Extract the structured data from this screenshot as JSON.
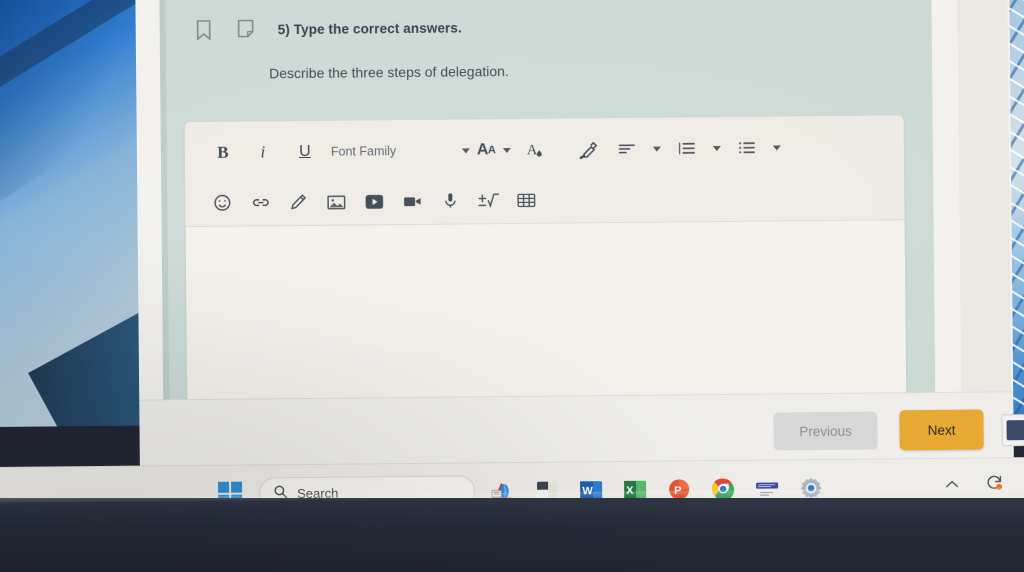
{
  "question": {
    "number_label": "5) Type the correct answers.",
    "prompt": "Describe the three steps of delegation.",
    "bookmark_icon": "bookmark-icon",
    "note_icon": "note-icon",
    "background_color": "#c9d8d4"
  },
  "editor": {
    "toolbar_row1": [
      {
        "name": "bold-button",
        "label": "B",
        "type": "text"
      },
      {
        "name": "italic-button",
        "label": "i",
        "type": "text"
      },
      {
        "name": "underline-button",
        "label": "U",
        "type": "text"
      },
      {
        "name": "font-family-select",
        "label": "Font Family",
        "type": "select"
      },
      {
        "name": "font-size-button",
        "label": "AA",
        "type": "select"
      },
      {
        "name": "font-color-button",
        "label": "font-color-icon",
        "type": "icon"
      },
      {
        "name": "highlight-button",
        "label": "highlighter-icon",
        "type": "icon"
      },
      {
        "name": "align-button",
        "label": "align-left-icon",
        "type": "select"
      },
      {
        "name": "numbered-list-button",
        "label": "numbered-list-icon",
        "type": "select"
      },
      {
        "name": "bullet-list-button",
        "label": "bullet-list-icon",
        "type": "select"
      }
    ],
    "toolbar_row2": [
      {
        "name": "emoji-button",
        "label": "smiley-icon"
      },
      {
        "name": "link-button",
        "label": "link-icon"
      },
      {
        "name": "draw-button",
        "label": "pencil-icon"
      },
      {
        "name": "image-button",
        "label": "image-icon"
      },
      {
        "name": "video-button",
        "label": "video-play-icon"
      },
      {
        "name": "record-button",
        "label": "camcorder-icon"
      },
      {
        "name": "audio-button",
        "label": "microphone-icon"
      },
      {
        "name": "math-button",
        "label": "math-symbol-icon"
      },
      {
        "name": "table-button",
        "label": "table-icon"
      }
    ],
    "answer_text": "",
    "answer_placeholder": "",
    "cursor": "text-caret",
    "surface_color": "#ece8e1",
    "field_color": "#f2efe9"
  },
  "navigation": {
    "previous_label": "Previous",
    "next_label": "Next",
    "previous_disabled": true,
    "next_color": "#e8a62c",
    "previous_color": "#d5d5d5"
  },
  "taskbar": {
    "start_label": "windows-start-icon",
    "search_placeholder": "Search",
    "search_icon": "search-icon",
    "apps": [
      {
        "name": "taskbar-app-widgets",
        "icon": "weather-widget-icon",
        "running": false
      },
      {
        "name": "taskbar-app-file-explorer",
        "icon": "file-explorer-icon",
        "running": false
      },
      {
        "name": "taskbar-app-word",
        "icon": "word-icon",
        "running": false
      },
      {
        "name": "taskbar-app-excel",
        "icon": "excel-icon",
        "running": false
      },
      {
        "name": "taskbar-app-powerpoint",
        "icon": "powerpoint-icon",
        "running": false
      },
      {
        "name": "taskbar-app-chrome",
        "icon": "chrome-icon",
        "running": true
      },
      {
        "name": "taskbar-app-notes",
        "icon": "blue-app-icon",
        "running": false
      },
      {
        "name": "taskbar-app-settings",
        "icon": "settings-gear-icon",
        "running": true
      }
    ],
    "tray": [
      {
        "name": "show-hidden-icons-button",
        "icon": "chevron-up-icon"
      },
      {
        "name": "sync-status-icon",
        "icon": "sync-icon"
      }
    ]
  },
  "colors": {
    "page_background": "#f0efeb",
    "question_background": "#c9d8d4",
    "accent_orange": "#e8a62c",
    "taskbar": "#eceae5",
    "bezel": "#262b37"
  }
}
